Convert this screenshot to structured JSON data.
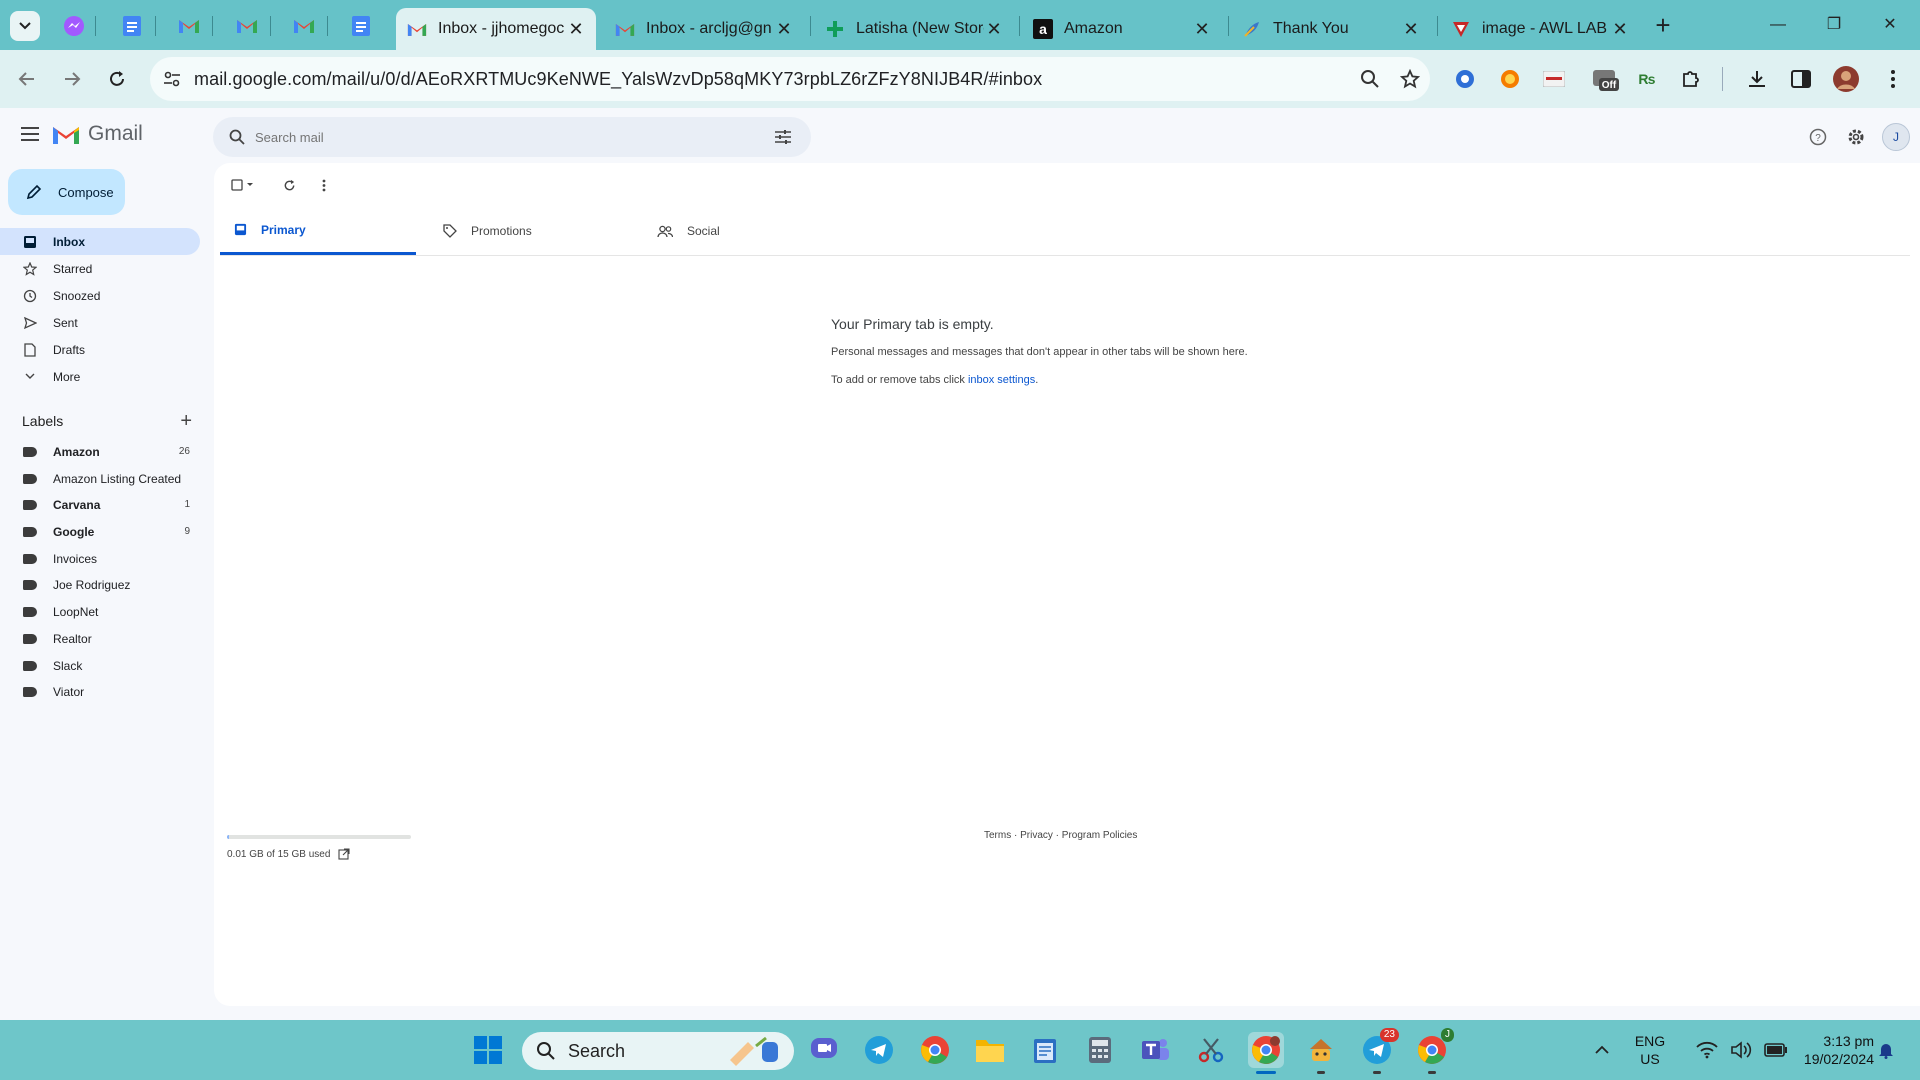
{
  "browser": {
    "tabs": [
      {
        "title": "Inbox - jjhomegoc",
        "active": true
      },
      {
        "title": "Inbox - arcljg@gn",
        "active": false
      },
      {
        "title": "Latisha (New Store",
        "active": false
      },
      {
        "title": "Amazon",
        "active": false
      },
      {
        "title": "Thank You",
        "active": false
      },
      {
        "title": "image - AWL LAB",
        "active": false
      }
    ],
    "url": "mail.google.com/mail/u/0/d/AEoRXRTMUc9KeNWE_YalsWzvDp58qMKY73rpbLZ6rZFzY8NIJB4R/#inbox",
    "ext_off_label": "Off"
  },
  "gmail": {
    "brand": "Gmail",
    "search_placeholder": "Search mail",
    "compose_label": "Compose",
    "account_initial": "J",
    "nav": [
      {
        "label": "Inbox",
        "icon": "inbox-icon"
      },
      {
        "label": "Starred",
        "icon": "star-icon"
      },
      {
        "label": "Snoozed",
        "icon": "clock-icon"
      },
      {
        "label": "Sent",
        "icon": "send-icon"
      },
      {
        "label": "Drafts",
        "icon": "draft-icon"
      },
      {
        "label": "More",
        "icon": "chevron-down-icon"
      }
    ],
    "labels_heading": "Labels",
    "labels": [
      {
        "name": "Amazon",
        "count": "26",
        "bold": true
      },
      {
        "name": "Amazon Listing Created",
        "count": "",
        "bold": false
      },
      {
        "name": "Carvana",
        "count": "1",
        "bold": true
      },
      {
        "name": "Google",
        "count": "9",
        "bold": true
      },
      {
        "name": "Invoices",
        "count": "",
        "bold": false
      },
      {
        "name": "Joe Rodriguez",
        "count": "",
        "bold": false
      },
      {
        "name": "LoopNet",
        "count": "",
        "bold": false
      },
      {
        "name": "Realtor",
        "count": "",
        "bold": false
      },
      {
        "name": "Slack",
        "count": "",
        "bold": false
      },
      {
        "name": "Viator",
        "count": "",
        "bold": false
      }
    ],
    "category_tabs": [
      {
        "label": "Primary",
        "icon": "inbox-tab-icon"
      },
      {
        "label": "Promotions",
        "icon": "tag-icon"
      },
      {
        "label": "Social",
        "icon": "people-icon"
      }
    ],
    "empty": {
      "title": "Your Primary tab is empty.",
      "message": "Personal messages and messages that don't appear in other tabs will be shown here.",
      "settings_prefix": "To add or remove tabs click ",
      "settings_link": "inbox settings",
      "settings_suffix": "."
    },
    "storage": {
      "text": "0.01 GB of 15 GB used",
      "used_fraction": 0.001
    },
    "footer": "Terms · Privacy · Program Policies"
  },
  "taskbar": {
    "search_label": "Search",
    "telegram_badge": "23",
    "chrome_profile_badge": "J",
    "lang_line1": "ENG",
    "lang_line2": "US",
    "time": "3:13 pm",
    "date": "19/02/2024"
  },
  "colors": {
    "chrome_frame": "#66c2c8",
    "toolbar": "#dff1f2",
    "gmail_bg": "#f6f8fc",
    "accent": "#0b57d0",
    "compose": "#c2e7ff",
    "nav_active": "#d3e3fd",
    "taskbar": "#6ec6c9"
  }
}
